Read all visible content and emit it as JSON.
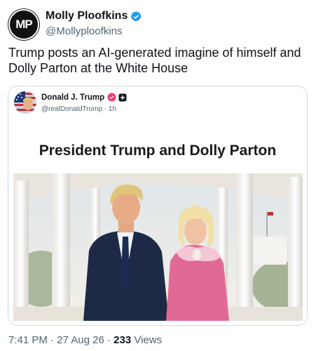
{
  "author": {
    "display_name": "Molly Ploofkins",
    "handle": "@Mollyploofkins",
    "avatar_initials": "MP"
  },
  "tweet": {
    "text": "Trump posts an AI-generated imagine of himself and Dolly Parton at the White House"
  },
  "quoted": {
    "display_name": "Donald J. Trump",
    "handle_time": "@realDonaldTrump · 1h",
    "headline": "President Trump and Dolly Parton"
  },
  "meta": {
    "time": "7:41 PM",
    "date": "27 Aug 26",
    "views_count": "233",
    "views_label": "Views",
    "separator": "·"
  },
  "colors": {
    "verified": "#1d9bf0",
    "trump_badge": "#f33a6a"
  }
}
